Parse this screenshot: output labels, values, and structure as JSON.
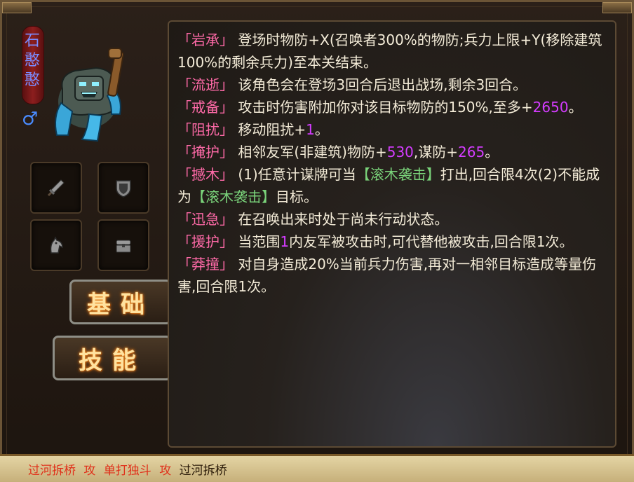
{
  "hero": {
    "name_chars": [
      "石",
      "憨",
      "憨"
    ],
    "gender_symbol": "♂"
  },
  "tabs": {
    "basic": "基础",
    "skills": "技能"
  },
  "equipment_slots": [
    "sword-icon",
    "shield-icon",
    "horse-icon",
    "treasure-chest-icon"
  ],
  "skills": [
    {
      "name": "「岩承」",
      "desc": "登场时物防+X(召唤者300%的物防;兵力上限+Y(移除建筑100%的剩余兵力)至本关结束。"
    },
    {
      "name": "「流逝」",
      "desc": "该角色会在登场3回合后退出战场,剩余3回合。"
    },
    {
      "name": "「戒备」",
      "desc_pre": "攻击时伤害附加你对该目标物防的150%,至多+",
      "num": "2650",
      "desc_post": "。"
    },
    {
      "name": "「阻扰」",
      "desc_pre": "移动阻扰+",
      "num": "1",
      "desc_post": "。"
    },
    {
      "name": "「掩护」",
      "desc_pre": "相邻友军(非建筑)物防+",
      "num": "530",
      "desc_mid": ",谋防+",
      "num2": "265",
      "desc_post": "。"
    },
    {
      "name": "「撼木」",
      "desc_pre": "(1)任意计谋牌可当",
      "hl": "【滚木袭击】",
      "desc_mid": "打出,回合限4次(2)不能成为",
      "hl2": "【滚木袭击】",
      "desc_post": "目标。"
    },
    {
      "name": "「迅急」",
      "desc": "在召唤出来时处于尚未行动状态。"
    },
    {
      "name": "「援护」",
      "desc_pre": "当范围",
      "num": "1",
      "desc_post": "内友军被攻击时,可代替他被攻击,回合限1次。"
    },
    {
      "name": "「莽撞」",
      "desc": "对自身造成20%当前兵力伤害,再对一相邻目标造成等量伤害,回合限1次。"
    }
  ],
  "bottom_bar": {
    "item1": "过河拆桥",
    "sep1": "攻",
    "item2": "单打独斗",
    "sep2": "攻",
    "item3": "过河拆桥"
  },
  "colors": {
    "skill_name": "#ff6aa8",
    "number": "#d43cff",
    "highlight": "#7ad37a",
    "text": "#f4ecd8"
  }
}
